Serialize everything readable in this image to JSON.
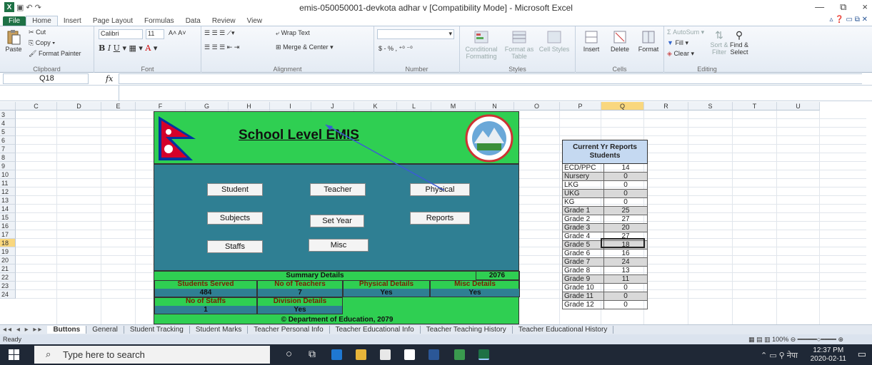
{
  "window": {
    "title": "emis-050050001-devkota adhar v  [Compatibility Mode]  -  Microsoft Excel",
    "controls": [
      "—",
      "⧉",
      "×"
    ]
  },
  "ribbon_tabs": [
    "File",
    "Home",
    "Insert",
    "Page Layout",
    "Formulas",
    "Data",
    "Review",
    "View"
  ],
  "ribbon": {
    "clipboard": {
      "label": "Clipboard",
      "paste": "Paste",
      "cut": "Cut",
      "copy": "Copy",
      "format_painter": "Format Painter"
    },
    "font": {
      "label": "Font",
      "name": "Calibri",
      "size": "11"
    },
    "alignment": {
      "label": "Alignment",
      "wrap_text": "Wrap Text",
      "merge_center": "Merge & Center"
    },
    "number": {
      "label": "Number",
      "currency": "$ - % ,"
    },
    "styles": {
      "label": "Styles",
      "conditional": "Conditional Formatting",
      "format_table": "Format as Table",
      "cell_styles": "Cell Styles"
    },
    "cells": {
      "label": "Cells",
      "insert": "Insert",
      "delete": "Delete",
      "format": "Format"
    },
    "editing": {
      "label": "Editing",
      "autosum": "AutoSum",
      "fill": "Fill",
      "clear": "Clear",
      "sort_filter": "Sort & Filter",
      "find_select": "Find & Select"
    }
  },
  "formula_bar": {
    "name_box": "Q18",
    "fx": "fx",
    "value": ""
  },
  "columns": [
    "C",
    "D",
    "E",
    "F",
    "G",
    "H",
    "I",
    "J",
    "K",
    "L",
    "M",
    "N",
    "O",
    "P",
    "Q",
    "R",
    "S",
    "T",
    "U"
  ],
  "rows": [
    "3",
    "4",
    "5",
    "6",
    "7",
    "8",
    "9",
    "10",
    "11",
    "12",
    "13",
    "14",
    "15",
    "16",
    "17",
    "18",
    "19",
    "20",
    "21",
    "22",
    "23",
    "24"
  ],
  "selected_column": "Q",
  "selected_row": "18",
  "dashboard": {
    "title": "School Level EMIS",
    "buttons": {
      "student": "Student",
      "teacher": "Teacher",
      "physical": "Physical",
      "subjects": "Subjects",
      "set_year": "Set Year",
      "reports": "Reports",
      "staffs": "Staffs",
      "misc": "Misc"
    },
    "summary": {
      "title": "Summary Details",
      "year": "2076",
      "students_served_label": "Students Served",
      "students_served": "484",
      "teachers_label": "No of Teachers",
      "teachers": "7",
      "physical_label": "Physical Details",
      "physical": "Yes",
      "misc_label": "Misc Details",
      "misc": "Yes",
      "staffs_label": "No of Staffs",
      "staffs": "1",
      "division_label": "Division Details",
      "division": "Yes",
      "footer": "© Department of Education, 2079"
    }
  },
  "reports": {
    "header_line1": "Current Yr Reports",
    "header_line2": "Students",
    "rows": [
      {
        "grade": "ECD/PPC",
        "count": "14"
      },
      {
        "grade": "Nursery",
        "count": "0"
      },
      {
        "grade": "LKG",
        "count": "0"
      },
      {
        "grade": "UKG",
        "count": "0"
      },
      {
        "grade": "KG",
        "count": "0"
      },
      {
        "grade": "Grade 1",
        "count": "25"
      },
      {
        "grade": "Grade 2",
        "count": "27"
      },
      {
        "grade": "Grade 3",
        "count": "20"
      },
      {
        "grade": "Grade 4",
        "count": "27"
      },
      {
        "grade": "Grade 5",
        "count": "18"
      },
      {
        "grade": "Grade 6",
        "count": "16"
      },
      {
        "grade": "Grade 7",
        "count": "24"
      },
      {
        "grade": "Grade 8",
        "count": "13"
      },
      {
        "grade": "Grade 9",
        "count": "11"
      },
      {
        "grade": "Grade 10",
        "count": "0"
      },
      {
        "grade": "Grade 11",
        "count": "0"
      },
      {
        "grade": "Grade 12",
        "count": "0"
      }
    ]
  },
  "sheet_tabs": [
    "Buttons",
    "General",
    "Student Tracking",
    "Student Marks",
    "Teacher Personal Info",
    "Teacher Educational Info",
    "Teacher Teaching History",
    "Teacher Educational History"
  ],
  "status": {
    "text": "Ready",
    "zoom": "100%"
  },
  "taskbar": {
    "search_placeholder": "Type here to search",
    "time": "12:37 PM",
    "date": "2020-02-11",
    "lang": "नेपा"
  }
}
